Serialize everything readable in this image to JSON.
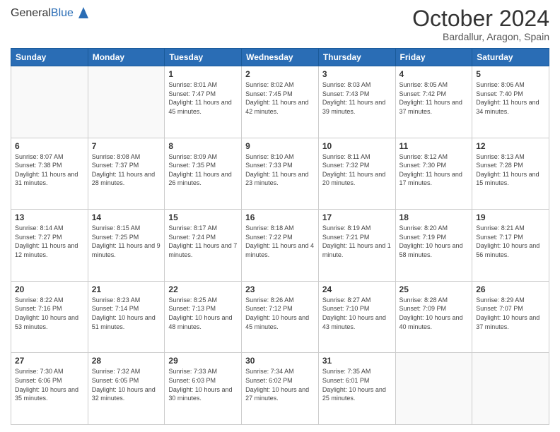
{
  "header": {
    "logo_general": "General",
    "logo_blue": "Blue",
    "month_title": "October 2024",
    "location": "Bardallur, Aragon, Spain"
  },
  "weekdays": [
    "Sunday",
    "Monday",
    "Tuesday",
    "Wednesday",
    "Thursday",
    "Friday",
    "Saturday"
  ],
  "weeks": [
    [
      {
        "day": "",
        "info": ""
      },
      {
        "day": "",
        "info": ""
      },
      {
        "day": "1",
        "info": "Sunrise: 8:01 AM\nSunset: 7:47 PM\nDaylight: 11 hours and 45 minutes."
      },
      {
        "day": "2",
        "info": "Sunrise: 8:02 AM\nSunset: 7:45 PM\nDaylight: 11 hours and 42 minutes."
      },
      {
        "day": "3",
        "info": "Sunrise: 8:03 AM\nSunset: 7:43 PM\nDaylight: 11 hours and 39 minutes."
      },
      {
        "day": "4",
        "info": "Sunrise: 8:05 AM\nSunset: 7:42 PM\nDaylight: 11 hours and 37 minutes."
      },
      {
        "day": "5",
        "info": "Sunrise: 8:06 AM\nSunset: 7:40 PM\nDaylight: 11 hours and 34 minutes."
      }
    ],
    [
      {
        "day": "6",
        "info": "Sunrise: 8:07 AM\nSunset: 7:38 PM\nDaylight: 11 hours and 31 minutes."
      },
      {
        "day": "7",
        "info": "Sunrise: 8:08 AM\nSunset: 7:37 PM\nDaylight: 11 hours and 28 minutes."
      },
      {
        "day": "8",
        "info": "Sunrise: 8:09 AM\nSunset: 7:35 PM\nDaylight: 11 hours and 26 minutes."
      },
      {
        "day": "9",
        "info": "Sunrise: 8:10 AM\nSunset: 7:33 PM\nDaylight: 11 hours and 23 minutes."
      },
      {
        "day": "10",
        "info": "Sunrise: 8:11 AM\nSunset: 7:32 PM\nDaylight: 11 hours and 20 minutes."
      },
      {
        "day": "11",
        "info": "Sunrise: 8:12 AM\nSunset: 7:30 PM\nDaylight: 11 hours and 17 minutes."
      },
      {
        "day": "12",
        "info": "Sunrise: 8:13 AM\nSunset: 7:28 PM\nDaylight: 11 hours and 15 minutes."
      }
    ],
    [
      {
        "day": "13",
        "info": "Sunrise: 8:14 AM\nSunset: 7:27 PM\nDaylight: 11 hours and 12 minutes."
      },
      {
        "day": "14",
        "info": "Sunrise: 8:15 AM\nSunset: 7:25 PM\nDaylight: 11 hours and 9 minutes."
      },
      {
        "day": "15",
        "info": "Sunrise: 8:17 AM\nSunset: 7:24 PM\nDaylight: 11 hours and 7 minutes."
      },
      {
        "day": "16",
        "info": "Sunrise: 8:18 AM\nSunset: 7:22 PM\nDaylight: 11 hours and 4 minutes."
      },
      {
        "day": "17",
        "info": "Sunrise: 8:19 AM\nSunset: 7:21 PM\nDaylight: 11 hours and 1 minute."
      },
      {
        "day": "18",
        "info": "Sunrise: 8:20 AM\nSunset: 7:19 PM\nDaylight: 10 hours and 58 minutes."
      },
      {
        "day": "19",
        "info": "Sunrise: 8:21 AM\nSunset: 7:17 PM\nDaylight: 10 hours and 56 minutes."
      }
    ],
    [
      {
        "day": "20",
        "info": "Sunrise: 8:22 AM\nSunset: 7:16 PM\nDaylight: 10 hours and 53 minutes."
      },
      {
        "day": "21",
        "info": "Sunrise: 8:23 AM\nSunset: 7:14 PM\nDaylight: 10 hours and 51 minutes."
      },
      {
        "day": "22",
        "info": "Sunrise: 8:25 AM\nSunset: 7:13 PM\nDaylight: 10 hours and 48 minutes."
      },
      {
        "day": "23",
        "info": "Sunrise: 8:26 AM\nSunset: 7:12 PM\nDaylight: 10 hours and 45 minutes."
      },
      {
        "day": "24",
        "info": "Sunrise: 8:27 AM\nSunset: 7:10 PM\nDaylight: 10 hours and 43 minutes."
      },
      {
        "day": "25",
        "info": "Sunrise: 8:28 AM\nSunset: 7:09 PM\nDaylight: 10 hours and 40 minutes."
      },
      {
        "day": "26",
        "info": "Sunrise: 8:29 AM\nSunset: 7:07 PM\nDaylight: 10 hours and 37 minutes."
      }
    ],
    [
      {
        "day": "27",
        "info": "Sunrise: 7:30 AM\nSunset: 6:06 PM\nDaylight: 10 hours and 35 minutes."
      },
      {
        "day": "28",
        "info": "Sunrise: 7:32 AM\nSunset: 6:05 PM\nDaylight: 10 hours and 32 minutes."
      },
      {
        "day": "29",
        "info": "Sunrise: 7:33 AM\nSunset: 6:03 PM\nDaylight: 10 hours and 30 minutes."
      },
      {
        "day": "30",
        "info": "Sunrise: 7:34 AM\nSunset: 6:02 PM\nDaylight: 10 hours and 27 minutes."
      },
      {
        "day": "31",
        "info": "Sunrise: 7:35 AM\nSunset: 6:01 PM\nDaylight: 10 hours and 25 minutes."
      },
      {
        "day": "",
        "info": ""
      },
      {
        "day": "",
        "info": ""
      }
    ]
  ]
}
